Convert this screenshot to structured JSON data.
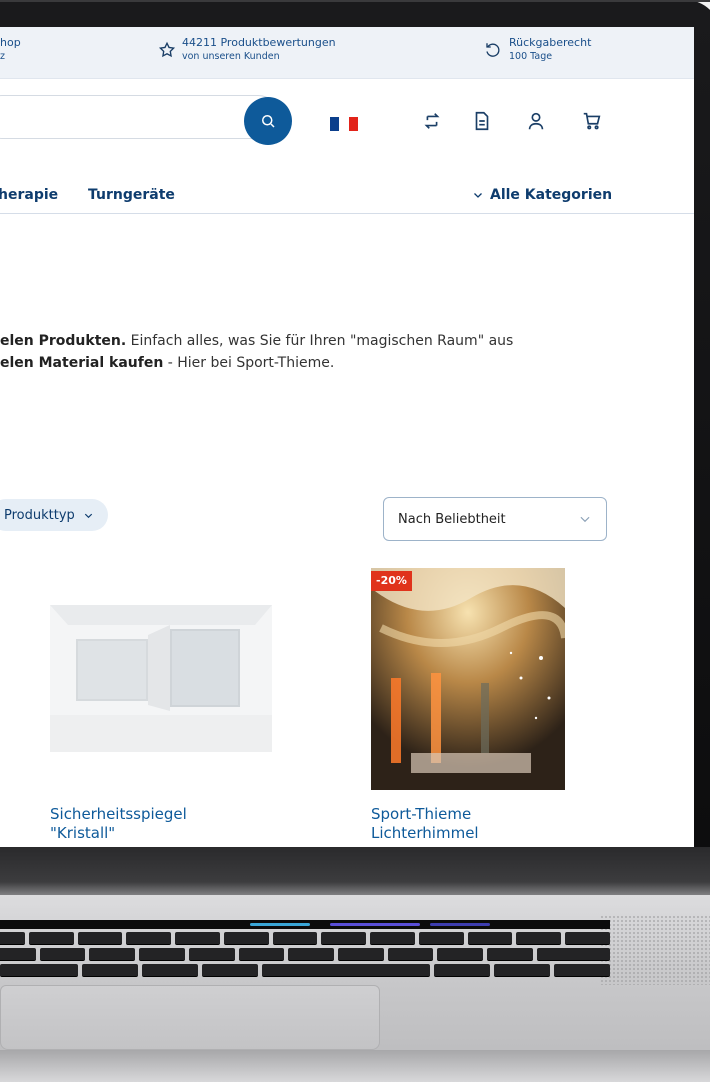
{
  "topbar": {
    "shop_label": "hop",
    "shop_sub": "z",
    "reviews_label": "44211 Produktbewertungen",
    "reviews_sub": "von unseren Kunden",
    "return_label": "Rückgaberecht",
    "return_sub": "100 Tage"
  },
  "header": {
    "search_icon": "search-icon",
    "flag": "flag-france",
    "icons": [
      "compare-icon",
      "document-icon",
      "account-icon",
      "cart-icon"
    ]
  },
  "nav": {
    "items": [
      "herapie",
      "Turngeräte"
    ],
    "all_categories": "Alle Kategorien"
  },
  "intro": {
    "line1_bold": "elen Produkten.",
    "line1_rest": " Einfach alles, was Sie für Ihren \"magischen Raum\" aus",
    "line2_bold": "elen Material kaufen",
    "line2_rest": " - Hier bei Sport-Thieme."
  },
  "filters": {
    "product_type": "Produkttyp",
    "sort_value": "Nach Beliebtheit"
  },
  "products": [
    {
      "title_line1": "Sicherheitsspiegel",
      "title_line2": "\"Kristall\""
    },
    {
      "title_line1": "Sport-Thieme",
      "title_line2": "Lichterhimmel",
      "badge": "-20%"
    }
  ],
  "colors": {
    "brand_blue": "#0e5a9a",
    "nav_blue": "#0e3c6e",
    "sale_red": "#e0331b",
    "topbar_bg": "#eef2f7"
  }
}
